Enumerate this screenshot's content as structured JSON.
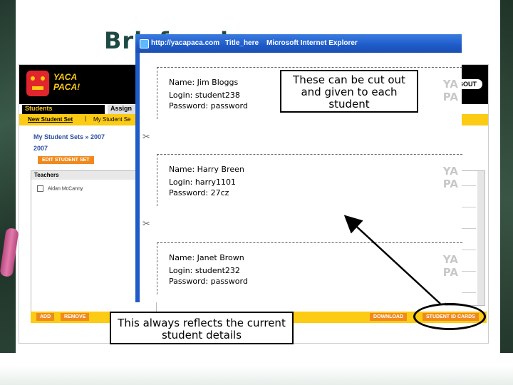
{
  "slide": {
    "title": "Briefcard"
  },
  "app": {
    "logo_line1": "YACA",
    "logo_line2": "PACA!",
    "logout_label": "LOGOUT",
    "tabs": [
      {
        "label": "Students"
      },
      {
        "label": "Assign"
      }
    ],
    "subnav": {
      "new_student_set": "New Student Set",
      "separator": "|",
      "my_student_sets": "My Student Se"
    },
    "breadcrumb": "My Student Sets » 2007",
    "set_name": "2007",
    "edit_button": "EDIT STUDENT SET",
    "teachers_header": "Teachers",
    "teacher_name": "Aidan McCanny",
    "buttons": {
      "add": "ADD",
      "remove": "REMOVE",
      "download": "DOWNLOAD",
      "student_id_cards": "STUDENT ID CARDS"
    }
  },
  "ie_window": {
    "url": "http://yacapaca.com",
    "page_title": "Title_here",
    "app_name": "Microsoft Internet Explorer"
  },
  "cards": [
    {
      "name": "Name: Jim Bloggs",
      "login": "Login: student238",
      "password": "Password: password"
    },
    {
      "name": "Name: Harry Breen",
      "login": "Login: harry1101",
      "password": "Password: 27cz"
    },
    {
      "name": "Name: Janet Brown",
      "login": "Login: student232",
      "password": "Password: password"
    }
  ],
  "card_brand": {
    "line1": "YA",
    "line2": "PA"
  },
  "scissors_glyph": "✂",
  "callouts": {
    "top": "These can be cut out and given to each student",
    "bottom": "This always reflects the current student details"
  }
}
